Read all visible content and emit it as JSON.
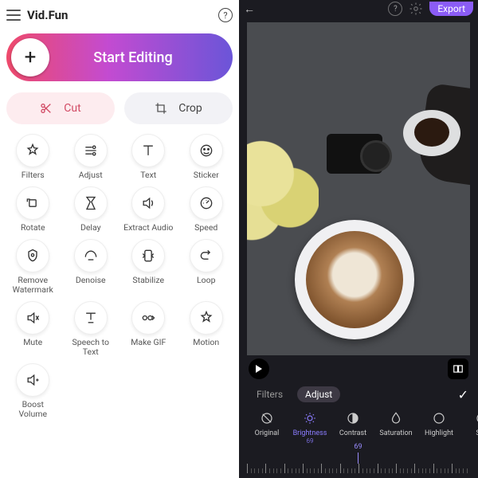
{
  "left": {
    "brand": "Vid.Fun",
    "hero_label": "Start Editing",
    "cut_label": "Cut",
    "crop_label": "Crop",
    "tools": [
      {
        "id": "filters",
        "label": "Filters"
      },
      {
        "id": "adjust",
        "label": "Adjust"
      },
      {
        "id": "text",
        "label": "Text"
      },
      {
        "id": "sticker",
        "label": "Sticker"
      },
      {
        "id": "rotate",
        "label": "Rotate"
      },
      {
        "id": "delay",
        "label": "Delay"
      },
      {
        "id": "extract-audio",
        "label": "Extract Audio"
      },
      {
        "id": "speed",
        "label": "Speed"
      },
      {
        "id": "remove-watermark",
        "label": "Remove Watermark"
      },
      {
        "id": "denoise",
        "label": "Denoise"
      },
      {
        "id": "stabilize",
        "label": "Stabilize"
      },
      {
        "id": "loop",
        "label": "Loop"
      },
      {
        "id": "mute",
        "label": "Mute"
      },
      {
        "id": "speech-to-text",
        "label": "Speech to Text"
      },
      {
        "id": "make-gif",
        "label": "Make GIF"
      },
      {
        "id": "motion",
        "label": "Motion"
      },
      {
        "id": "boost-volume",
        "label": "Boost Volume"
      }
    ]
  },
  "right": {
    "export_label": "Export",
    "tab_filters": "Filters",
    "tab_adjust": "Adjust",
    "active_tab": "Adjust",
    "adjust_items": [
      {
        "id": "original",
        "label": "Original"
      },
      {
        "id": "brightness",
        "label": "Brightness",
        "value": "69",
        "active": true
      },
      {
        "id": "contrast",
        "label": "Contrast"
      },
      {
        "id": "saturation",
        "label": "Saturation"
      },
      {
        "id": "highlight",
        "label": "Highlight"
      },
      {
        "id": "shadow",
        "label": "Sha"
      }
    ],
    "slider_value": "69"
  }
}
